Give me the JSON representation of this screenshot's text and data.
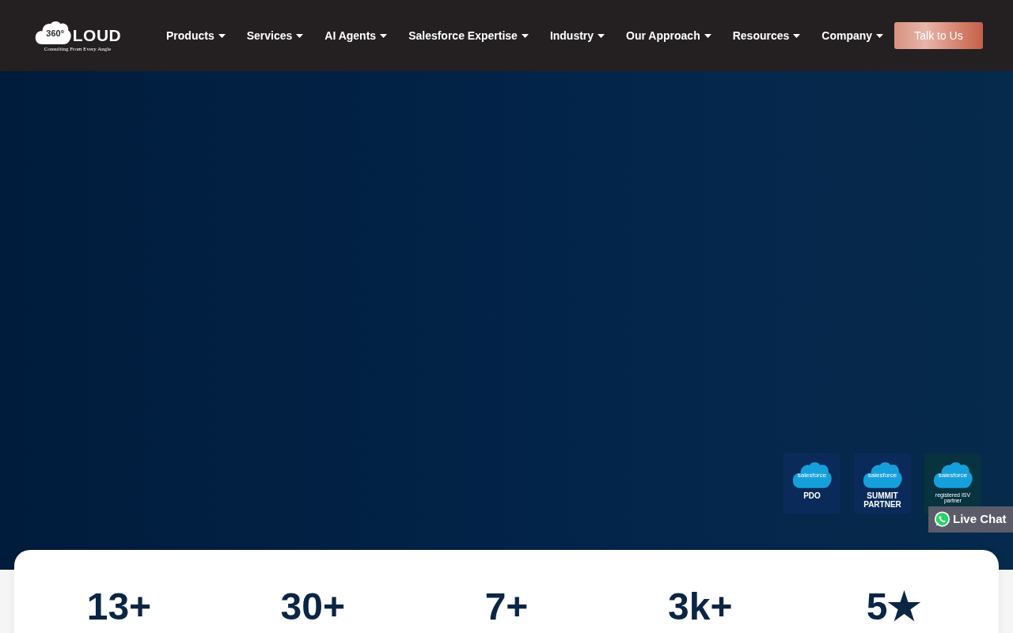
{
  "header": {
    "logo": {
      "badge": "360°",
      "wordmark": "LOUD",
      "tagline": "Consulting From Every Angle"
    },
    "nav": [
      "Products",
      "Services",
      "AI Agents",
      "Salesforce Expertise",
      "Industry",
      "Our Approach",
      "Resources",
      "Company"
    ],
    "cta": "Talk to Us"
  },
  "hero": {
    "badges": [
      {
        "logo": "salesforce",
        "label": "PDO",
        "color": "#0a2b5a"
      },
      {
        "logo": "salesforce",
        "label": "SUMMIT PARTNER",
        "color": "#0a2b5a"
      },
      {
        "logo": "salesforce",
        "label": "registered ISV partner",
        "color": "#07323f"
      }
    ]
  },
  "live_chat": {
    "label": "Live Chat"
  },
  "stats": [
    {
      "value": "13+"
    },
    {
      "value": "30+"
    },
    {
      "value": "7+"
    },
    {
      "value": "3k+"
    },
    {
      "value": "5★"
    }
  ]
}
